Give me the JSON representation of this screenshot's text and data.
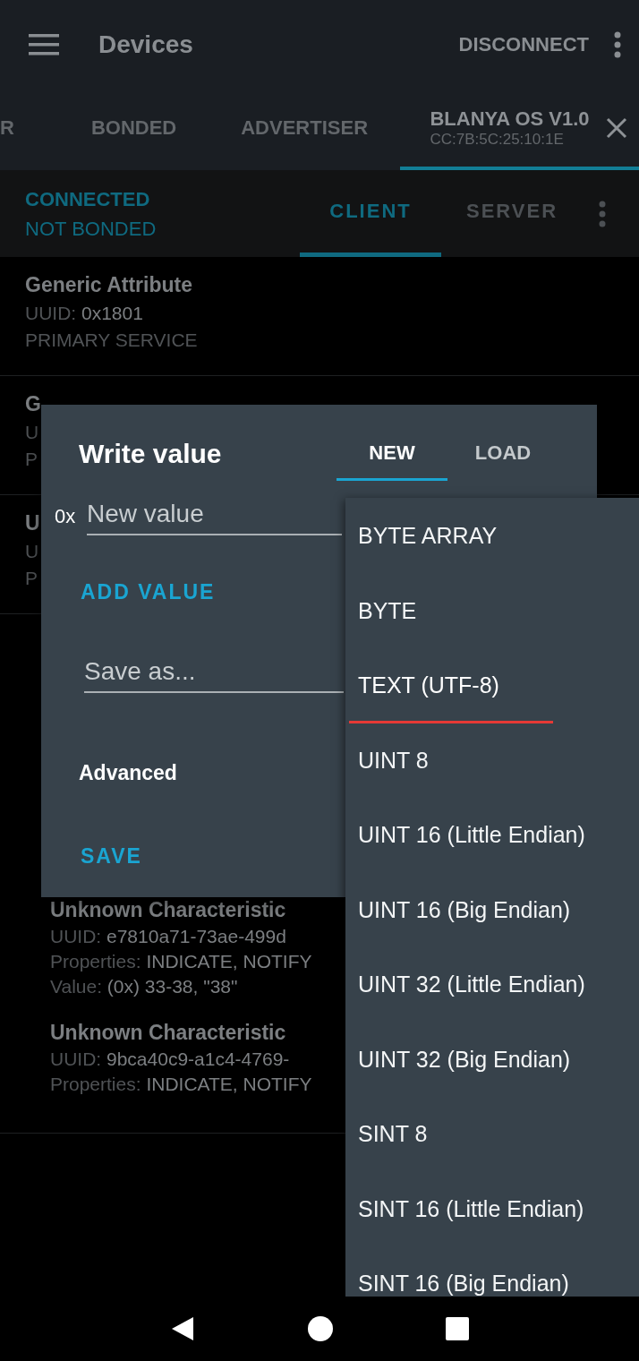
{
  "app_bar": {
    "title": "Devices",
    "action": "DISCONNECT"
  },
  "device_tabs": [
    {
      "label": "R",
      "selected": false
    },
    {
      "label": "BONDED",
      "selected": false
    },
    {
      "label": "ADVERTISER",
      "selected": false
    },
    {
      "label": "BLANYA OS V1.0",
      "subtitle": "CC:7B:5C:25:10:1E",
      "selected": true
    }
  ],
  "connection": {
    "status": "CONNECTED",
    "bond": "NOT BONDED"
  },
  "mode_tabs": [
    {
      "label": "CLIENT",
      "selected": true
    },
    {
      "label": "SERVER",
      "selected": false
    }
  ],
  "services": [
    {
      "name": "Generic Attribute",
      "uuid_label": "UUID:",
      "uuid": "0x1801",
      "type": "PRIMARY SERVICE"
    },
    {
      "name": "G",
      "uuid_label": "U",
      "type": "P"
    },
    {
      "name": "U",
      "uuid_label": "U",
      "type": "P"
    }
  ],
  "characteristics": [
    {
      "name": "Unknown Characteristic",
      "uuid_label": "UUID:",
      "uuid": "e7810a71-73ae-499d",
      "properties_label": "Properties:",
      "properties": "INDICATE, NOTIFY",
      "value_label": "Value:",
      "value": "(0x) 33-38, \"38\""
    },
    {
      "name": "Unknown Characteristic",
      "uuid_label": "UUID:",
      "uuid": "9bca40c9-a1c4-4769-",
      "properties_label": "Properties:",
      "properties": "INDICATE, NOTIFY"
    }
  ],
  "dialog": {
    "title": "Write value",
    "tabs": [
      {
        "label": "NEW",
        "selected": true
      },
      {
        "label": "LOAD",
        "selected": false
      }
    ],
    "prefix": "0x",
    "value_placeholder": "New value",
    "add_button": "ADD VALUE",
    "save_placeholder": "Save as...",
    "advanced": "Advanced",
    "save_button": "SAVE"
  },
  "format_menu": [
    {
      "label": "BYTE ARRAY",
      "selected": false
    },
    {
      "label": "BYTE",
      "selected": false
    },
    {
      "label": "TEXT (UTF-8)",
      "selected": true
    },
    {
      "label": "UINT 8",
      "selected": false
    },
    {
      "label": "UINT 16 (Little Endian)",
      "selected": false
    },
    {
      "label": "UINT 16 (Big Endian)",
      "selected": false
    },
    {
      "label": "UINT 32 (Little Endian)",
      "selected": false
    },
    {
      "label": "UINT 32 (Big Endian)",
      "selected": false
    },
    {
      "label": "SINT 8",
      "selected": false
    },
    {
      "label": "SINT 16 (Little Endian)",
      "selected": false
    },
    {
      "label": "SINT 16 (Big Endian)",
      "selected": false
    }
  ]
}
